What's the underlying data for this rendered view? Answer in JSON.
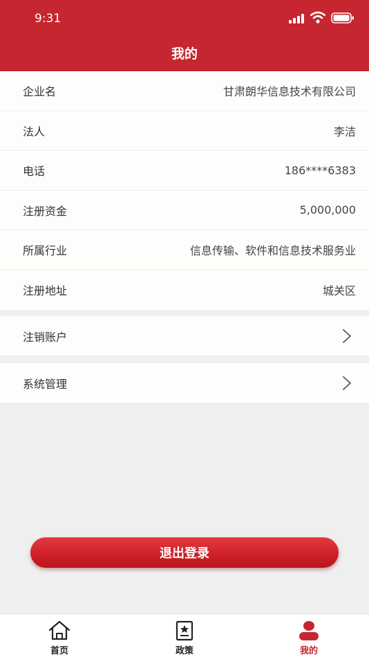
{
  "status_bar": {
    "time": "9:31"
  },
  "header": {
    "title": "我的"
  },
  "info_rows": [
    {
      "label": "企业名",
      "value": "甘肃朗华信息技术有限公司"
    },
    {
      "label": "法人",
      "value": "李洁"
    },
    {
      "label": "电话",
      "value": "186****6383"
    },
    {
      "label": "注册资金",
      "value": "5,000,000"
    },
    {
      "label": "所属行业",
      "value": "信息传输、软件和信息技术服务业"
    },
    {
      "label": "注册地址",
      "value": "城关区"
    }
  ],
  "actions": {
    "cancel_account": "注销账户",
    "system_manage": "系统管理"
  },
  "logout_label": "退出登录",
  "tabs": [
    {
      "label": "首页",
      "icon": "home-icon"
    },
    {
      "label": "政策",
      "icon": "policy-icon"
    },
    {
      "label": "我的",
      "icon": "profile-icon",
      "active": true
    }
  ],
  "colors": {
    "brand": "#c5262f",
    "background": "#efefef"
  }
}
